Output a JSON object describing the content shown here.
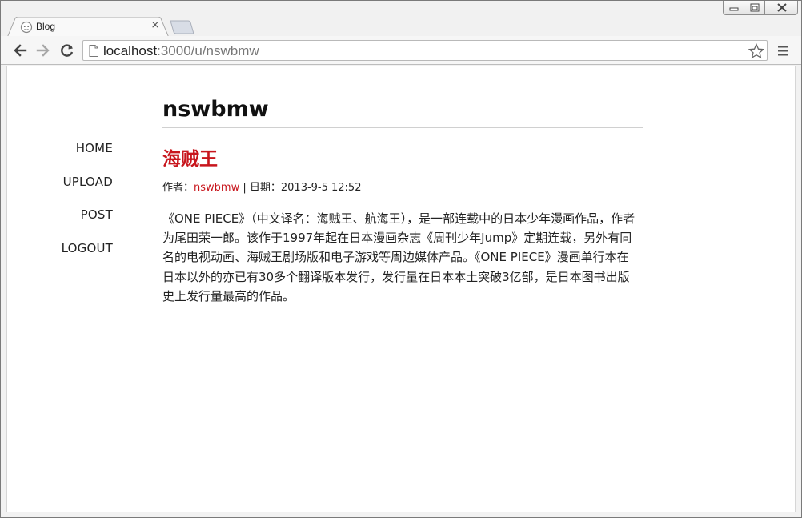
{
  "browser": {
    "tab_title": "Blog",
    "tab_close_glyph": "×",
    "url_host": "localhost",
    "url_rest": ":3000/u/nswbmw"
  },
  "nav": {
    "items": [
      {
        "label": "HOME"
      },
      {
        "label": "UPLOAD"
      },
      {
        "label": "POST"
      },
      {
        "label": "LOGOUT"
      }
    ]
  },
  "page": {
    "site_title": "nswbmw"
  },
  "post": {
    "title": "海贼王",
    "author_label": "作者：",
    "author": "nswbmw",
    "date_label": " | 日期：",
    "date": "2013-9-5 12:52",
    "body": "《ONE PIECE》（中文译名：海贼王、航海王），是一部连载中的日本少年漫画作品，作者为尾田荣一郎。该作于1997年起在日本漫画杂志《周刊少年Jump》定期连载，另外有同名的电视动画、海贼王剧场版和电子游戏等周边媒体产品。《ONE PIECE》漫画单行本在日本以外的亦已有30多个翻译版本发行，发行量在日本本土突破3亿部，是日本图书出版史上发行量最高的作品。"
  },
  "colors": {
    "accent": "#c8161d",
    "text": "#222222"
  },
  "icons": {
    "tab_favicon": "globe-face-icon",
    "back": "back-arrow-icon",
    "forward": "forward-arrow-icon",
    "reload": "reload-icon",
    "page": "page-icon",
    "star": "star-icon",
    "menu": "menu-icon"
  }
}
